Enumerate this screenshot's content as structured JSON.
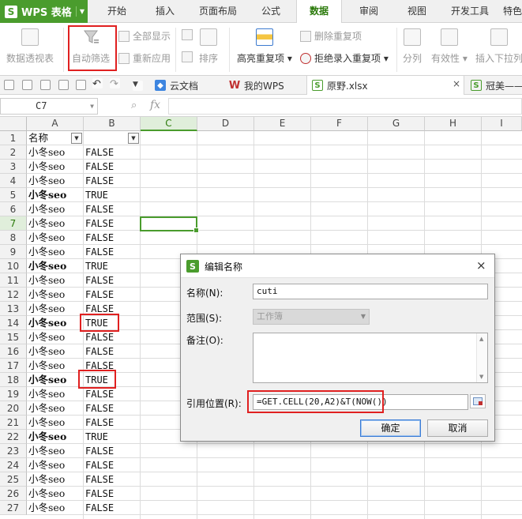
{
  "app": {
    "title": "WPS 表格"
  },
  "menu_tabs": [
    "开始",
    "插入",
    "页面布局",
    "公式",
    "数据",
    "审阅",
    "视图",
    "开发工具",
    "特色"
  ],
  "ribbon": {
    "pivot": "数据透视表",
    "autofilter": "自动筛选",
    "show_all": "全部显示",
    "reapply": "重新应用",
    "sort": "排序",
    "highlight_dup": "高亮重复项",
    "remove_dup": "删除重复项",
    "reject_dup": "拒绝录入重复项",
    "split": "分列",
    "validity": "有效性",
    "dropdown": "插入下拉列"
  },
  "doc_tabs": [
    "云文档",
    "我的WPS",
    "原野.xlsx",
    "冠美——"
  ],
  "formula_bar": {
    "cell_ref": "C7",
    "fx": "fx"
  },
  "columns": [
    "A",
    "B",
    "C",
    "D",
    "E",
    "F",
    "G",
    "H",
    "I"
  ],
  "header_row": {
    "a": "名称",
    "b": ""
  },
  "rows": [
    {
      "n": "1",
      "a": "名称",
      "b": ""
    },
    {
      "n": "2",
      "a": "小冬seo",
      "b": "FALSE"
    },
    {
      "n": "3",
      "a": "小冬seo",
      "b": "FALSE"
    },
    {
      "n": "4",
      "a": "小冬seo",
      "b": "FALSE"
    },
    {
      "n": "5",
      "a": "小冬seo",
      "b": "TRUE"
    },
    {
      "n": "6",
      "a": "小冬seo",
      "b": "FALSE"
    },
    {
      "n": "7",
      "a": "小冬seo",
      "b": "FALSE"
    },
    {
      "n": "8",
      "a": "小冬seo",
      "b": "FALSE"
    },
    {
      "n": "9",
      "a": "小冬seo",
      "b": "FALSE"
    },
    {
      "n": "10",
      "a": "小冬seo",
      "b": "TRUE"
    },
    {
      "n": "11",
      "a": "小冬seo",
      "b": "FALSE"
    },
    {
      "n": "12",
      "a": "小冬seo",
      "b": "FALSE"
    },
    {
      "n": "13",
      "a": "小冬seo",
      "b": "FALSE"
    },
    {
      "n": "14",
      "a": "小冬seo",
      "b": "TRUE"
    },
    {
      "n": "15",
      "a": "小冬seo",
      "b": "FALSE"
    },
    {
      "n": "16",
      "a": "小冬seo",
      "b": "FALSE"
    },
    {
      "n": "17",
      "a": "小冬seo",
      "b": "FALSE"
    },
    {
      "n": "18",
      "a": "小冬seo",
      "b": "TRUE"
    },
    {
      "n": "19",
      "a": "小冬seo",
      "b": "FALSE"
    },
    {
      "n": "20",
      "a": "小冬seo",
      "b": "FALSE"
    },
    {
      "n": "21",
      "a": "小冬seo",
      "b": "FALSE"
    },
    {
      "n": "22",
      "a": "小冬seo",
      "b": "TRUE"
    },
    {
      "n": "23",
      "a": "小冬seo",
      "b": "FALSE"
    },
    {
      "n": "24",
      "a": "小冬seo",
      "b": "FALSE"
    },
    {
      "n": "25",
      "a": "小冬seo",
      "b": "FALSE"
    },
    {
      "n": "26",
      "a": "小冬seo",
      "b": "FALSE"
    },
    {
      "n": "27",
      "a": "小冬seo",
      "b": "FALSE"
    }
  ],
  "dialog": {
    "title": "编辑名称",
    "close": "×",
    "name_label": "名称(N):",
    "name_value": "cuti",
    "scope_label": "范围(S):",
    "scope_value": "工作簿",
    "comment_label": "备注(O):",
    "ref_label": "引用位置(R):",
    "ref_value": "=GET.CELL(20,A2)&T(NOW())",
    "ok": "确定",
    "cancel": "取消"
  },
  "colors": {
    "brand_green": "#4a9c2d",
    "highlight_red": "#e02020"
  }
}
